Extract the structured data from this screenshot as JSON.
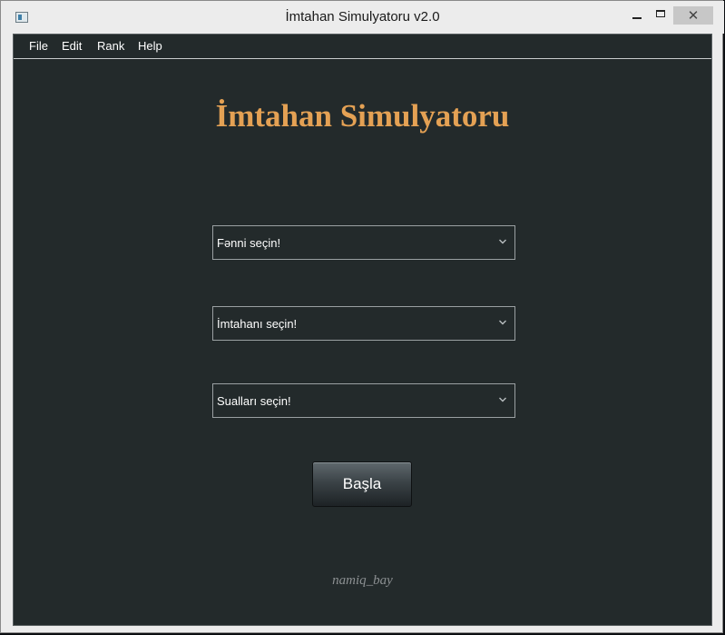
{
  "window": {
    "title": "İmtahan Simulyatoru v2.0",
    "controls": {
      "minimize": "minimize",
      "maximize": "maximize",
      "close": "✕"
    }
  },
  "menu": {
    "items": [
      {
        "label": "File"
      },
      {
        "label": "Edit"
      },
      {
        "label": "Rank"
      },
      {
        "label": "Help"
      }
    ]
  },
  "main": {
    "heading": "İmtahan Simulyatoru",
    "subject_select": {
      "value": "Fənni seçin!"
    },
    "exam_select": {
      "value": "İmtahanı seçin!"
    },
    "questions_select": {
      "value": "Sualları seçin!"
    },
    "start_label": "Başla",
    "credit": "namiq_bay"
  },
  "colors": {
    "background": "#232a2b",
    "heading": "#e4a154",
    "text": "#ffffff",
    "credit": "#8c9092"
  },
  "icons": {
    "app": "app-window-icon",
    "dropdown": "chevron-down-icon"
  }
}
